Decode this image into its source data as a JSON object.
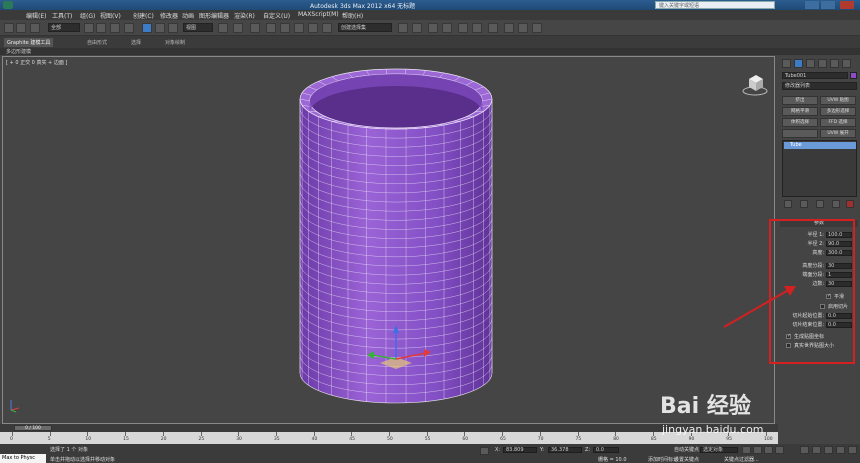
{
  "window": {
    "title": "Autodesk 3ds Max  2012 x64     无标题",
    "help_placeholder": "键入关键字或短语",
    "logo_icon": "3dsmax-logo-icon"
  },
  "menu": [
    "编辑(E)",
    "工具(T)",
    "组(G)",
    "视图(V)",
    "创建(C)",
    "修改器",
    "动画",
    "图形编辑器",
    "渲染(R)",
    "自定义(U)",
    "MAXScript(M)",
    "帮助(H)"
  ],
  "toolbar": {
    "selection_filter": "全部",
    "reference_coord": "视图",
    "named_selection": "创建选择集"
  },
  "ribbon": {
    "tabs": [
      "Graphite 建模工具",
      "自由形式",
      "选择",
      "对象绘制"
    ],
    "subtab": "多边形建模"
  },
  "viewport": {
    "label": "[ + 0 正交 0 真实 + 边面 ]",
    "object_color": "#8a4cc8"
  },
  "command_panel": {
    "object_name": "Tube001",
    "object_color": "#8a4cc8",
    "modifier_list": "修改器列表",
    "mod_buttons": [
      "挤出",
      "UVW 贴图",
      "网格平滑",
      "多边形选择",
      "体积选择",
      "FFD 选择",
      "",
      "UVW 展开"
    ],
    "stack_item": "Tube",
    "params": {
      "header": "参数",
      "radius1_label": "半径 1:",
      "radius1_value": "100.0",
      "radius2_label": "半径 2:",
      "radius2_value": "90.0",
      "height_label": "高度:",
      "height_value": "300.0",
      "height_segs_label": "高度分段:",
      "height_segs_value": "30",
      "cap_segs_label": "端面分段:",
      "cap_segs_value": "1",
      "sides_label": "边数:",
      "sides_value": "30",
      "smooth_label": "平滑",
      "slice_on_label": "启用切片",
      "slice_from_label": "切片起始位置:",
      "slice_from_value": "0.0",
      "slice_to_label": "切片结束位置:",
      "slice_to_value": "0.0",
      "gen_map_label": "生成贴图坐标",
      "real_world_label": "真实世界贴图大小"
    }
  },
  "timeline": {
    "thumb": "0 / 100",
    "ticks": [
      "0",
      "5",
      "10",
      "15",
      "20",
      "25",
      "30",
      "35",
      "40",
      "45",
      "50",
      "55",
      "60",
      "65",
      "70",
      "75",
      "80",
      "85",
      "90",
      "95",
      "100"
    ]
  },
  "status": {
    "maxscript": "Max to Physc",
    "selected": "选择了 1 个 对象",
    "prompt": "单击并拖动以选择并移动对象",
    "x": "83.809",
    "y": "36.378",
    "z": "0.0",
    "grid": "栅格 = 10.0",
    "add_time_tag": "添加时间标记",
    "auto_key": "自动关键点",
    "set_key": "设置关键点",
    "selected_obj": "选定对象",
    "key_filter": "关键点过滤器..."
  },
  "watermark": {
    "brand": "Bai 经验",
    "url": "jingyan.baidu.com"
  }
}
